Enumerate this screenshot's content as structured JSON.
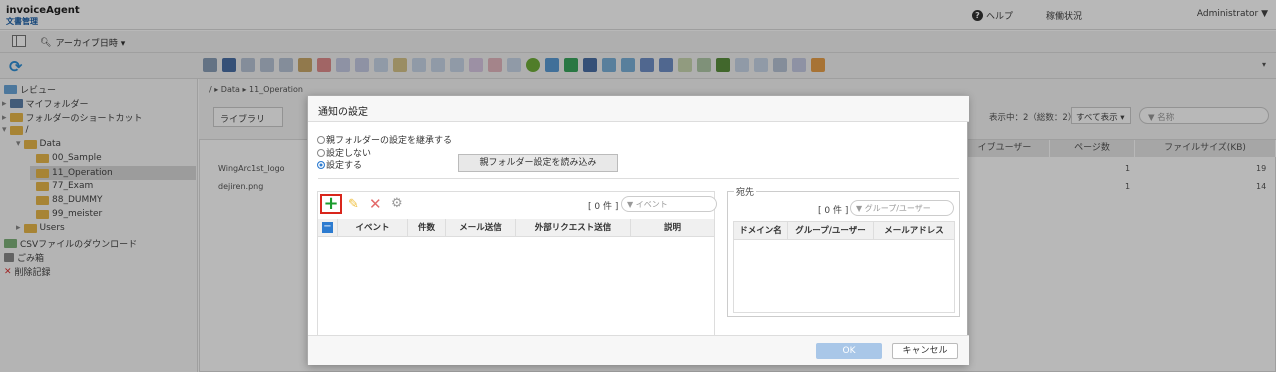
{
  "header": {
    "app_name": "invoiceAgent",
    "app_subtitle": "文書管理",
    "help_label": "ヘルプ",
    "status_label": "稼働状況",
    "user_label": "Administrator ▼"
  },
  "archive_bar": {
    "label": "アーカイブ日時 ▾"
  },
  "tree": {
    "items": [
      {
        "label": "レビュー"
      },
      {
        "label": "マイフォルダー"
      },
      {
        "label": "フォルダーのショートカット"
      },
      {
        "label": "/"
      },
      {
        "label": "Data"
      },
      {
        "label": "00_Sample"
      },
      {
        "label": "11_Operation"
      },
      {
        "label": "77_Exam"
      },
      {
        "label": "88_DUMMY"
      },
      {
        "label": "99_meister"
      },
      {
        "label": "Users"
      },
      {
        "label": "CSVファイルのダウンロード"
      },
      {
        "label": "ごみ箱"
      },
      {
        "label": "削除記録"
      }
    ]
  },
  "main": {
    "breadcrumb": "/ ▸ Data ▸ 11_Operation",
    "library_tab": "ライブラリ",
    "display_info": "表示中：2（総数：2）",
    "filter_select": "すべて表示",
    "name_filter": "名称",
    "columns": [
      "イブユーザー",
      "ページ数",
      "ファイルサイズ(KB)"
    ],
    "rows": [
      {
        "name": "WingArc1st_logo",
        "pages": "1",
        "size": "19"
      },
      {
        "name": "dejiren.png",
        "pages": "1",
        "size": "14"
      }
    ]
  },
  "dialog": {
    "title": "通知の設定",
    "radio_inherit": "親フォルダーの設定を継承する",
    "radio_none": "設定しない",
    "radio_set": "設定する",
    "load_button": "親フォルダー設定を読み込み",
    "events": {
      "count": "[ 0 件 ]",
      "search_placeholder": "イベント",
      "columns": [
        "イベント",
        "件数",
        "メール送信",
        "外部リクエスト送信",
        "説明"
      ]
    },
    "recipients": {
      "legend": "宛先",
      "count": "[ 0 件 ]",
      "search_placeholder": "グループ/ユーザー",
      "columns": [
        "ドメイン名",
        "グループ/ユーザー",
        "メールアドレス"
      ]
    },
    "ok_label": "OK",
    "cancel_label": "キャンセル"
  }
}
